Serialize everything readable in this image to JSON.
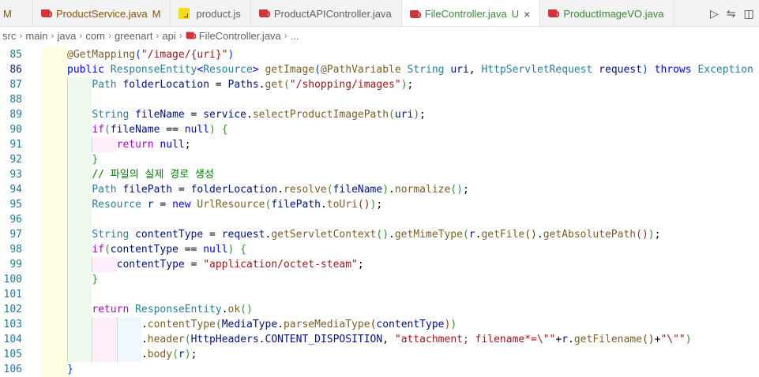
{
  "tabs": [
    {
      "label": "M",
      "icon": "none",
      "status": "",
      "active": false,
      "partial": true
    },
    {
      "label": "ProductService.java",
      "icon": "java-icon",
      "status": "M",
      "status_color": "#895503",
      "active": false
    },
    {
      "label": "product.js",
      "icon": "js-icon",
      "status": "",
      "active": false
    },
    {
      "label": "ProductAPIController.java",
      "icon": "java-icon",
      "status": "",
      "active": false
    },
    {
      "label": "FileController.java",
      "icon": "java-icon",
      "status": "U",
      "status_color": "#388a34",
      "active": true,
      "close": "×"
    },
    {
      "label": "ProductImageVO.java",
      "icon": "java-icon",
      "status": "",
      "active": false,
      "label_color": "#388a34"
    }
  ],
  "tab_actions": [
    {
      "name": "run-icon",
      "glyph": "▷"
    },
    {
      "name": "compare-changes-icon",
      "glyph": "⇋"
    },
    {
      "name": "split-editor-icon",
      "glyph": "◫"
    }
  ],
  "breadcrumb": [
    "src",
    "main",
    "java",
    "com",
    "greenart",
    "api",
    "FileController.java",
    "..."
  ],
  "editor": {
    "first_line": 85,
    "current_line": 86,
    "lines": [
      {
        "n": 85,
        "indent": 1,
        "tokens": [
          [
            "ann",
            "@GetMapping"
          ],
          [
            "b1",
            "("
          ],
          [
            "str",
            "\"/image/{uri}\""
          ],
          [
            "b1",
            ")"
          ]
        ]
      },
      {
        "n": 86,
        "indent": 1,
        "tokens": [
          [
            "kw",
            "public "
          ],
          [
            "type",
            "ResponseEntity"
          ],
          [
            "kw",
            "<"
          ],
          [
            "type",
            "Resource"
          ],
          [
            "kw",
            "> "
          ],
          [
            "fn",
            "getImage"
          ],
          [
            "b1",
            "("
          ],
          [
            "ann",
            "@PathVariable "
          ],
          [
            "type",
            "String "
          ],
          [
            "var",
            "uri"
          ],
          [
            "plain",
            ", "
          ],
          [
            "type",
            "HttpServletRequest "
          ],
          [
            "var",
            "request"
          ],
          [
            "b1",
            ")"
          ],
          [
            "plain",
            " "
          ],
          [
            "kw",
            "throws "
          ],
          [
            "type",
            "Exception "
          ],
          [
            "b1",
            "{"
          ]
        ]
      },
      {
        "n": 87,
        "indent": 2,
        "tokens": [
          [
            "type",
            "Path "
          ],
          [
            "var",
            "folderLocation"
          ],
          [
            "plain",
            " = "
          ],
          [
            "var",
            "Paths"
          ],
          [
            "plain",
            "."
          ],
          [
            "fn",
            "get"
          ],
          [
            "b2",
            "("
          ],
          [
            "str",
            "\"/shopping/images\""
          ],
          [
            "b2",
            ")"
          ],
          [
            "plain",
            ";"
          ]
        ]
      },
      {
        "n": 88,
        "indent": 2,
        "tokens": []
      },
      {
        "n": 89,
        "indent": 2,
        "tokens": [
          [
            "type",
            "String "
          ],
          [
            "var",
            "fileName"
          ],
          [
            "plain",
            " = "
          ],
          [
            "var",
            "service"
          ],
          [
            "plain",
            "."
          ],
          [
            "fn",
            "selectProductImagePath"
          ],
          [
            "b2",
            "("
          ],
          [
            "var",
            "uri"
          ],
          [
            "b2",
            ")"
          ],
          [
            "plain",
            ";"
          ]
        ]
      },
      {
        "n": 90,
        "indent": 2,
        "tokens": [
          [
            "ctrl",
            "if"
          ],
          [
            "b2",
            "("
          ],
          [
            "var",
            "fileName"
          ],
          [
            "plain",
            " == "
          ],
          [
            "kw",
            "null"
          ],
          [
            "b2",
            ")"
          ],
          [
            "plain",
            " "
          ],
          [
            "b2",
            "{"
          ]
        ]
      },
      {
        "n": 91,
        "indent": 3,
        "tokens": [
          [
            "ctrl",
            "return "
          ],
          [
            "kw",
            "null"
          ],
          [
            "plain",
            ";"
          ]
        ]
      },
      {
        "n": 92,
        "indent": 2,
        "tokens": [
          [
            "b2",
            "}"
          ]
        ]
      },
      {
        "n": 93,
        "indent": 2,
        "tokens": [
          [
            "cmt",
            "// 파일의 실제 경로 생성"
          ]
        ]
      },
      {
        "n": 94,
        "indent": 2,
        "tokens": [
          [
            "type",
            "Path "
          ],
          [
            "var",
            "filePath"
          ],
          [
            "plain",
            " = "
          ],
          [
            "var",
            "folderLocation"
          ],
          [
            "plain",
            "."
          ],
          [
            "fn",
            "resolve"
          ],
          [
            "b2",
            "("
          ],
          [
            "var",
            "fileName"
          ],
          [
            "b2",
            ")"
          ],
          [
            "plain",
            "."
          ],
          [
            "fn",
            "normalize"
          ],
          [
            "b2",
            "()"
          ],
          [
            "plain",
            ";"
          ]
        ]
      },
      {
        "n": 95,
        "indent": 2,
        "tokens": [
          [
            "type",
            "Resource "
          ],
          [
            "var",
            "r"
          ],
          [
            "plain",
            " = "
          ],
          [
            "kw",
            "new "
          ],
          [
            "fn",
            "UrlResource"
          ],
          [
            "b2",
            "("
          ],
          [
            "var",
            "filePath"
          ],
          [
            "plain",
            "."
          ],
          [
            "fn",
            "toUri"
          ],
          [
            "b3",
            "()"
          ],
          [
            "b2",
            ")"
          ],
          [
            "plain",
            ";"
          ]
        ]
      },
      {
        "n": 96,
        "indent": 2,
        "tokens": []
      },
      {
        "n": 97,
        "indent": 2,
        "tokens": [
          [
            "type",
            "String "
          ],
          [
            "var",
            "contentType"
          ],
          [
            "plain",
            " = "
          ],
          [
            "var",
            "request"
          ],
          [
            "plain",
            "."
          ],
          [
            "fn",
            "getServletContext"
          ],
          [
            "b2",
            "()"
          ],
          [
            "plain",
            "."
          ],
          [
            "fn",
            "getMimeType"
          ],
          [
            "b2",
            "("
          ],
          [
            "var",
            "r"
          ],
          [
            "plain",
            "."
          ],
          [
            "fn",
            "getFile"
          ],
          [
            "b3",
            "()"
          ],
          [
            "plain",
            "."
          ],
          [
            "fn",
            "getAbsolutePath"
          ],
          [
            "b3",
            "()"
          ],
          [
            "b2",
            ")"
          ],
          [
            "plain",
            ";"
          ]
        ]
      },
      {
        "n": 98,
        "indent": 2,
        "tokens": [
          [
            "ctrl",
            "if"
          ],
          [
            "b2",
            "("
          ],
          [
            "var",
            "contentType"
          ],
          [
            "plain",
            " == "
          ],
          [
            "kw",
            "null"
          ],
          [
            "b2",
            ")"
          ],
          [
            "plain",
            " "
          ],
          [
            "b2",
            "{"
          ]
        ]
      },
      {
        "n": 99,
        "indent": 3,
        "tokens": [
          [
            "var",
            "contentType"
          ],
          [
            "plain",
            " = "
          ],
          [
            "str",
            "\"application/octet-steam\""
          ],
          [
            "plain",
            ";"
          ]
        ]
      },
      {
        "n": 100,
        "indent": 2,
        "tokens": [
          [
            "b2",
            "}"
          ]
        ]
      },
      {
        "n": 101,
        "indent": 2,
        "tokens": []
      },
      {
        "n": 102,
        "indent": 2,
        "tokens": [
          [
            "ctrl",
            "return "
          ],
          [
            "type",
            "ResponseEntity"
          ],
          [
            "plain",
            "."
          ],
          [
            "fn",
            "ok"
          ],
          [
            "b2",
            "()"
          ]
        ]
      },
      {
        "n": 103,
        "indent": 4,
        "tokens": [
          [
            "plain",
            "."
          ],
          [
            "fn",
            "contentType"
          ],
          [
            "b2",
            "("
          ],
          [
            "var",
            "MediaType"
          ],
          [
            "plain",
            "."
          ],
          [
            "fn",
            "parseMediaType"
          ],
          [
            "b3",
            "("
          ],
          [
            "var",
            "contentType"
          ],
          [
            "b3",
            ")"
          ],
          [
            "b2",
            ")"
          ]
        ]
      },
      {
        "n": 104,
        "indent": 4,
        "tokens": [
          [
            "plain",
            "."
          ],
          [
            "fn",
            "header"
          ],
          [
            "b2",
            "("
          ],
          [
            "var",
            "HttpHeaders"
          ],
          [
            "plain",
            "."
          ],
          [
            "var",
            "CONTENT_DISPOSITION"
          ],
          [
            "plain",
            ", "
          ],
          [
            "str",
            "\"attachment; filename*=\\\"\""
          ],
          [
            "plain",
            "+"
          ],
          [
            "var",
            "r"
          ],
          [
            "plain",
            "."
          ],
          [
            "fn",
            "getFilename"
          ],
          [
            "b3",
            "()"
          ],
          [
            "plain",
            "+"
          ],
          [
            "str",
            "\"\\\"\""
          ],
          [
            "b2",
            ")"
          ]
        ]
      },
      {
        "n": 105,
        "indent": 4,
        "tokens": [
          [
            "plain",
            "."
          ],
          [
            "fn",
            "body"
          ],
          [
            "b2",
            "("
          ],
          [
            "var",
            "r"
          ],
          [
            "b2",
            ")"
          ],
          [
            "plain",
            ";"
          ]
        ]
      },
      {
        "n": 106,
        "indent": 1,
        "tokens": [
          [
            "b1",
            "}"
          ]
        ]
      }
    ]
  }
}
